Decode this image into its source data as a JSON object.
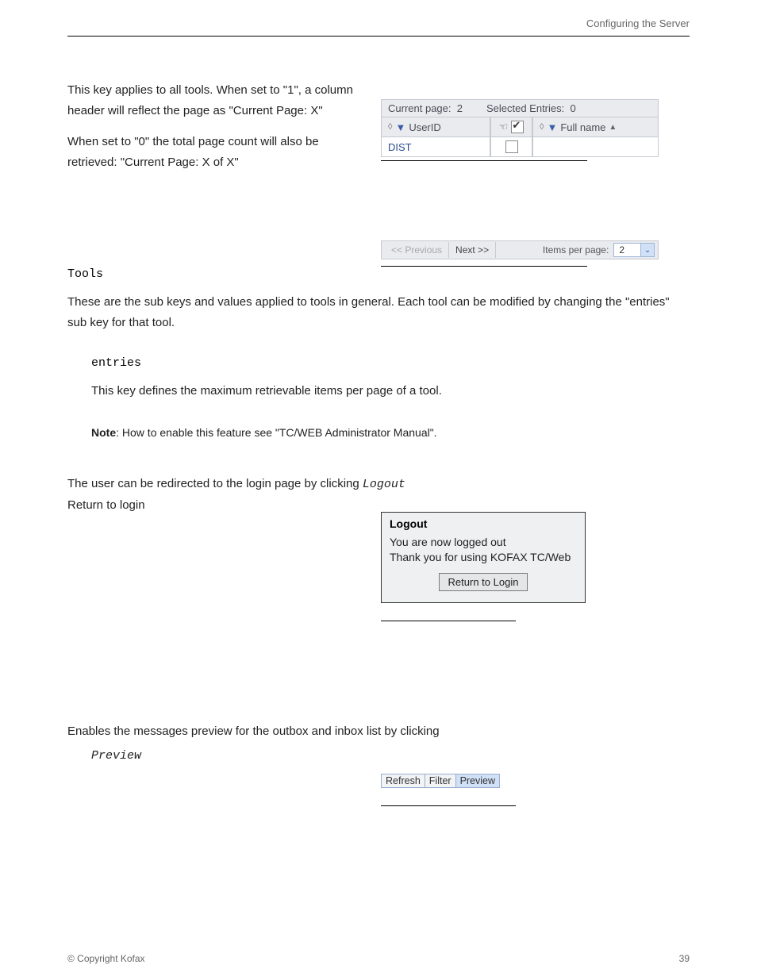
{
  "header": {
    "right": "Configuring the Server"
  },
  "text": {
    "p1a": "This key applies to all tools. When set to \"1\", a column header will reflect the page as \"Current Page: X\"",
    "p1b": "When set to \"0\" the total page count will also be retrieved: \"Current Page: X of X\"",
    "tools": "Tools",
    "tool_detail": "These are the sub keys and values applied to tools in general. Each tool can be modified by changing the \"entries\" sub key for that tool.",
    "entries_label": "entries",
    "entries_text": "This key defines the maximum retrievable items per page of a tool.",
    "note": ": How to enable this feature see \"TC/WEB Administrator Manual\".",
    "note_bold": "Note",
    "logout_label": "Logout",
    "logout_text": "The user can be redirected to the  login page by clicking",
    "logout_link": "Return to login",
    "preview_label": "Preview",
    "preview_text": "Enables the messages preview for the outbox and inbox list by clicking",
    "preview_btn": "Preview"
  },
  "fig1": {
    "current_page_label": "Current page:",
    "current_page_value": "2",
    "selected_label": "Selected Entries:",
    "selected_value": "0",
    "col1": "UserID",
    "col2": "Full name",
    "row1": "DIST"
  },
  "fig2": {
    "prev": "<< Previous",
    "next": "Next >>",
    "label": "Items per page:",
    "value": "2"
  },
  "fig3": {
    "title": "Logout",
    "line1": "You are now logged out",
    "line2": "Thank you for using KOFAX TC/Web",
    "button": "Return to Login"
  },
  "fig4": {
    "b1": "Refresh",
    "b2": "Filter",
    "b3": "Preview"
  },
  "footer": {
    "left": "© Copyright Kofax",
    "right": "39"
  }
}
